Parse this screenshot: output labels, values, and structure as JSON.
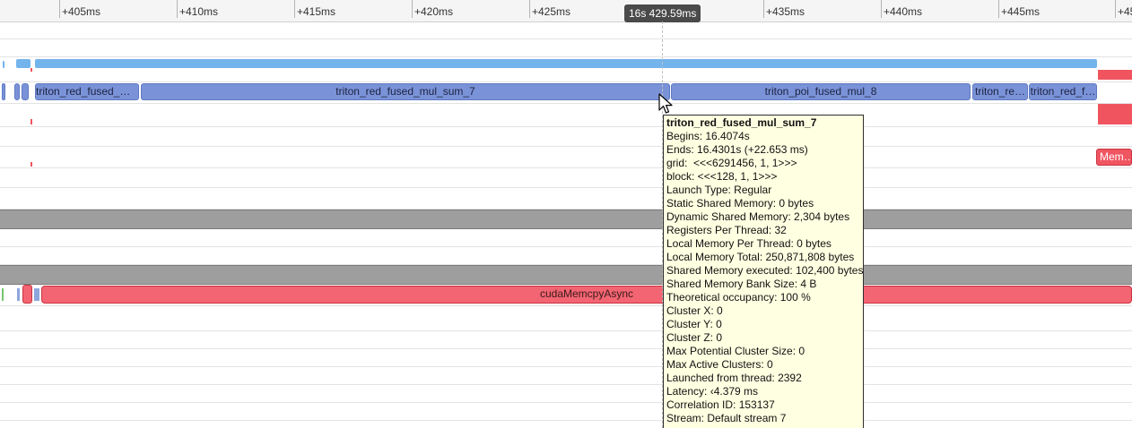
{
  "ruler": {
    "ticks": [
      "+405ms",
      "+410ms",
      "+415ms",
      "+420ms",
      "+425ms",
      "+435ms",
      "+440ms",
      "+445ms",
      "+45"
    ],
    "cursor_time": "16s 429.59ms"
  },
  "kernels": {
    "k1": "triton_red_fused_m…",
    "k2": "triton_red_fused_mul_sum_7",
    "k3": "triton_poi_fused_mul_8",
    "k4": "triton_re…",
    "k5": "triton_red_f…"
  },
  "memcpy_label": "cudaMemcpyAsync",
  "mem_chip": "Mem…",
  "tooltip": {
    "title": "triton_red_fused_mul_sum_7",
    "lines": [
      "Begins: 16.4074s",
      "Ends: 16.4301s (+22.653 ms)",
      "grid:  <<<6291456, 1, 1>>>",
      "block: <<<128, 1, 1>>>",
      "Launch Type: Regular",
      "Static Shared Memory: 0 bytes",
      "Dynamic Shared Memory: 2,304 bytes",
      "Registers Per Thread: 32",
      "Local Memory Per Thread: 0 bytes",
      "Local Memory Total: 250,871,808 bytes",
      "Shared Memory executed: 102,400 bytes",
      "Shared Memory Bank Size: 4 B",
      "Theoretical occupancy: 100 %",
      "Cluster X: 0",
      "Cluster Y: 0",
      "Cluster Z: 0",
      "Max Potential Cluster Size: 0",
      "Max Active Clusters: 0",
      "Launched from thread: 2392",
      "Latency: ‹4.379 ms",
      "Correlation ID: 153137",
      "Stream: Default stream 7"
    ]
  },
  "colors": {
    "kernel": "#7a93d8",
    "runtime": "#74b4ec",
    "memcpy": "#f36572",
    "tooltip_bg": "#ffffe1"
  }
}
